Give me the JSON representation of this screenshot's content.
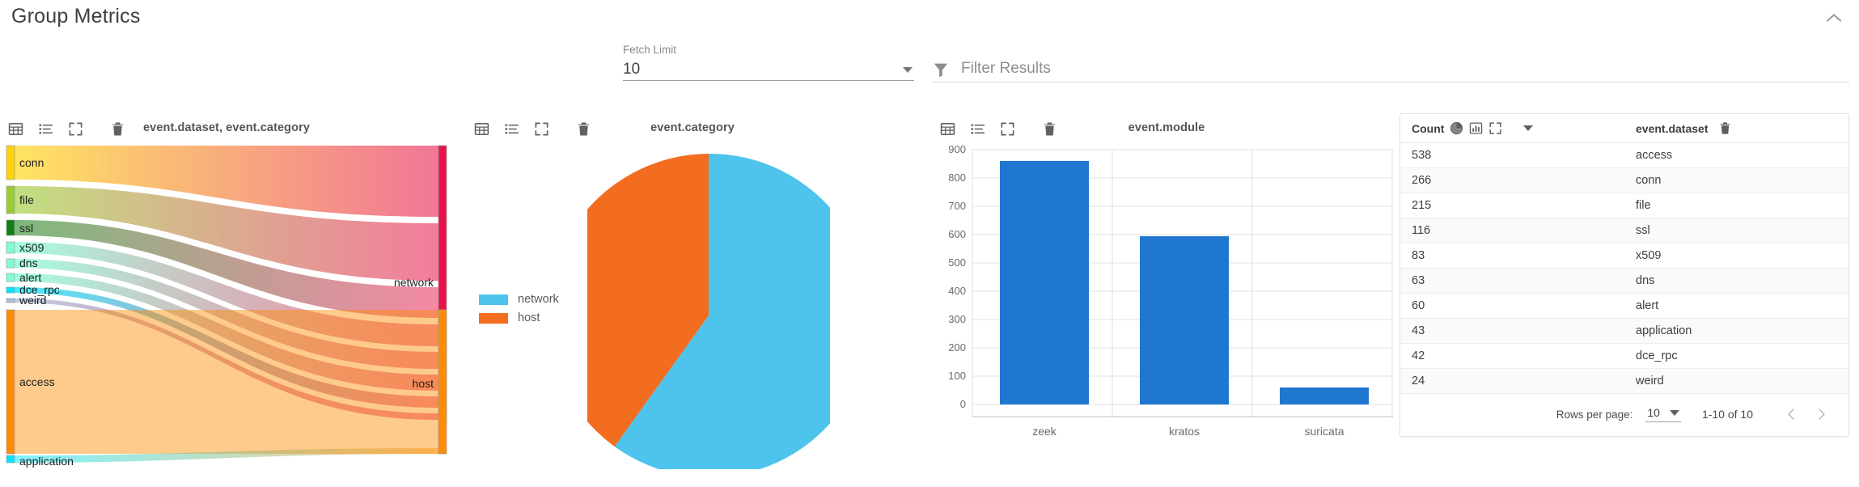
{
  "header": {
    "title": "Group Metrics",
    "collapse_icon": "chevron-up-icon"
  },
  "controls": {
    "fetch_limit": {
      "label": "Fetch Limit",
      "value": "10",
      "caret_icon": "chevron-down-icon"
    },
    "filter": {
      "icon": "filter-icon",
      "placeholder": "Filter Results",
      "value": ""
    }
  },
  "panel_toolbar": {
    "table_icon": "table-grid-icon",
    "list_icon": "list-icon",
    "fullscreen_icon": "fullscreen-icon",
    "delete_icon": "trash-icon"
  },
  "panels": {
    "sankey": {
      "title": "event.dataset, event.category"
    },
    "pie": {
      "title": "event.category"
    },
    "bar": {
      "title": "event.module"
    }
  },
  "table": {
    "columns": [
      {
        "label": "Count",
        "icons": [
          "pie-chart-icon",
          "bar-chart-icon",
          "fullscreen-icon",
          "chevron-down-icon"
        ]
      },
      {
        "label": "event.dataset",
        "icons": [
          "trash-icon"
        ]
      }
    ],
    "rows": [
      {
        "count": "538",
        "dataset": "access"
      },
      {
        "count": "266",
        "dataset": "conn"
      },
      {
        "count": "215",
        "dataset": "file"
      },
      {
        "count": "116",
        "dataset": "ssl"
      },
      {
        "count": "83",
        "dataset": "x509"
      },
      {
        "count": "63",
        "dataset": "dns"
      },
      {
        "count": "60",
        "dataset": "alert"
      },
      {
        "count": "43",
        "dataset": "application"
      },
      {
        "count": "42",
        "dataset": "dce_rpc"
      },
      {
        "count": "24",
        "dataset": "weird"
      }
    ],
    "pagination": {
      "rows_per_page_label": "Rows per page:",
      "rows_per_page_value": "10",
      "range": "1-10 of 10",
      "prev_icon": "chevron-left-icon",
      "next_icon": "chevron-right-icon"
    }
  },
  "chart_data": [
    {
      "type": "sankey",
      "title": "event.dataset, event.category",
      "nodes_left": [
        {
          "label": "conn",
          "value": 266,
          "color": "#ffd400"
        },
        {
          "label": "file",
          "value": 215,
          "color": "#9acd32"
        },
        {
          "label": "ssl",
          "value": 116,
          "color": "#108010"
        },
        {
          "label": "x509",
          "value": 83,
          "color": "#7fffd4"
        },
        {
          "label": "dns",
          "value": 63,
          "color": "#7fffd4"
        },
        {
          "label": "alert",
          "value": 60,
          "color": "#7fffd4"
        },
        {
          "label": "dce_rpc",
          "value": 42,
          "color": "#00e5ff"
        },
        {
          "label": "weird",
          "value": 24,
          "color": "#a8c0dd"
        },
        {
          "label": "access",
          "value": 538,
          "color": "#ff8c00"
        },
        {
          "label": "application",
          "value": 43,
          "color": "#00e5ff"
        }
      ],
      "nodes_right": [
        {
          "label": "network",
          "value": 869,
          "color": "#e8134b"
        },
        {
          "label": "host",
          "value": 581,
          "color": "#ff8c00"
        }
      ],
      "links": [
        {
          "source": "conn",
          "target": "network",
          "value": 266
        },
        {
          "source": "file",
          "target": "network",
          "value": 215
        },
        {
          "source": "ssl",
          "target": "network",
          "value": 116
        },
        {
          "source": "x509",
          "target": "network",
          "value": 83
        },
        {
          "source": "dns",
          "target": "network",
          "value": 63
        },
        {
          "source": "alert",
          "target": "network",
          "value": 60
        },
        {
          "source": "dce_rpc",
          "target": "network",
          "value": 42
        },
        {
          "source": "weird",
          "target": "network",
          "value": 24
        },
        {
          "source": "access",
          "target": "host",
          "value": 538
        },
        {
          "source": "application",
          "target": "host",
          "value": 43
        }
      ]
    },
    {
      "type": "pie",
      "title": "event.category",
      "labels": [
        "network",
        "host"
      ],
      "values": [
        869,
        581
      ],
      "percentages": [
        59.9,
        40.1
      ],
      "colors": [
        "#4ec3ec",
        "#f36d21"
      ],
      "legend_position": "left"
    },
    {
      "type": "bar",
      "title": "event.module",
      "categories": [
        "zeek",
        "kratos",
        "suricata"
      ],
      "values": [
        860,
        595,
        60
      ],
      "xlabel": "",
      "ylabel": "",
      "ylim": [
        0,
        900
      ],
      "yticks": [
        0,
        100,
        200,
        300,
        400,
        500,
        600,
        700,
        800,
        900
      ],
      "grid": true,
      "color": "#1f77d0"
    }
  ]
}
